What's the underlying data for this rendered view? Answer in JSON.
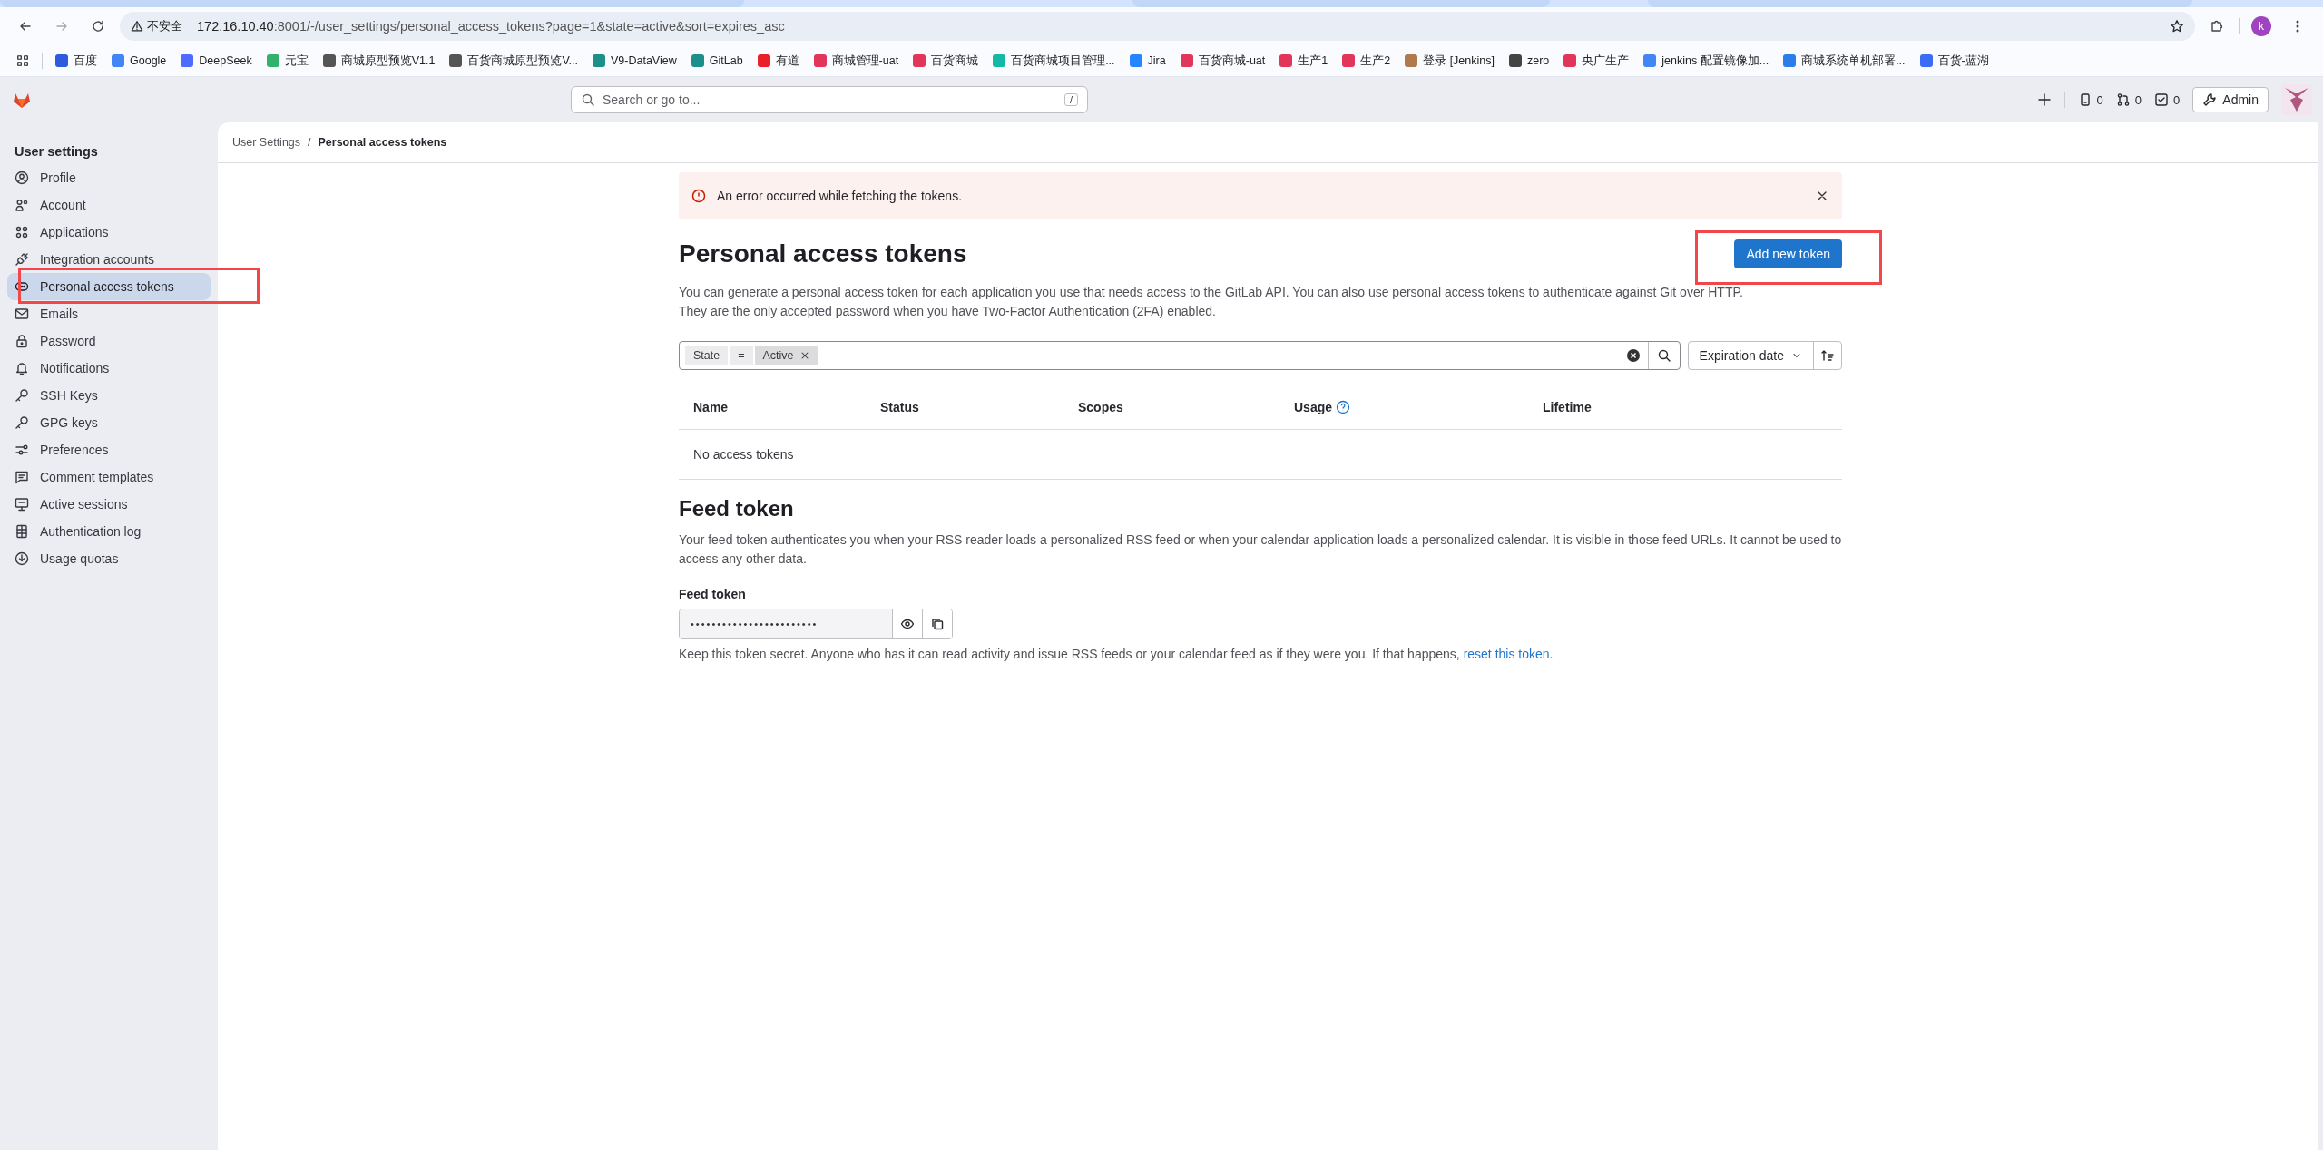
{
  "browser": {
    "security_label": "不安全",
    "url_host": "172.16.10.40",
    "url_rest": ":8001/-/user_settings/personal_access_tokens?page=1&state=active&sort=expires_asc",
    "profile_initial": "k"
  },
  "bookmarks": [
    {
      "label": "百度",
      "color": "#2e5bdb"
    },
    {
      "label": "Google",
      "color": "#4285f4"
    },
    {
      "label": "DeepSeek",
      "color": "#4d6bfe"
    },
    {
      "label": "元宝",
      "color": "#31b26b"
    },
    {
      "label": "商城原型预览V1.1",
      "color": "#555555"
    },
    {
      "label": "百货商城原型预览V...",
      "color": "#555555"
    },
    {
      "label": "V9-DataView",
      "color": "#1d8f8a"
    },
    {
      "label": "GitLab",
      "color": "#1d8f8a"
    },
    {
      "label": "有道",
      "color": "#e8202b"
    },
    {
      "label": "商城管理-uat",
      "color": "#e2355a"
    },
    {
      "label": "百货商城",
      "color": "#e2355a"
    },
    {
      "label": "百货商城项目管理...",
      "color": "#14b8a6"
    },
    {
      "label": "Jira",
      "color": "#2684ff"
    },
    {
      "label": "百货商城-uat",
      "color": "#e2355a"
    },
    {
      "label": "生产1",
      "color": "#e2355a"
    },
    {
      "label": "生产2",
      "color": "#e2355a"
    },
    {
      "label": "登录 [Jenkins]",
      "color": "#b07a4a"
    },
    {
      "label": "zero",
      "color": "#444444"
    },
    {
      "label": "央广生产",
      "color": "#e2355a"
    },
    {
      "label": "jenkins 配置镜像加...",
      "color": "#4285f4"
    },
    {
      "label": "商城系统单机部署...",
      "color": "#2b7de9"
    },
    {
      "label": "百货-蓝湖",
      "color": "#3b6cf6"
    }
  ],
  "header": {
    "search": {
      "placeholder": "Search or go to...",
      "shortcut": "/"
    },
    "issues_count": "0",
    "merge_requests_count": "0",
    "todos_count": "0",
    "admin_button": "Admin"
  },
  "sidebar": {
    "title": "User settings",
    "items": [
      {
        "label": "Profile",
        "selected": false
      },
      {
        "label": "Account",
        "selected": false
      },
      {
        "label": "Applications",
        "selected": false
      },
      {
        "label": "Integration accounts",
        "selected": false
      },
      {
        "label": "Personal access tokens",
        "selected": true
      },
      {
        "label": "Emails",
        "selected": false
      },
      {
        "label": "Password",
        "selected": false
      },
      {
        "label": "Notifications",
        "selected": false
      },
      {
        "label": "SSH Keys",
        "selected": false
      },
      {
        "label": "GPG keys",
        "selected": false
      },
      {
        "label": "Preferences",
        "selected": false
      },
      {
        "label": "Comment templates",
        "selected": false
      },
      {
        "label": "Active sessions",
        "selected": false
      },
      {
        "label": "Authentication log",
        "selected": false
      },
      {
        "label": "Usage quotas",
        "selected": false
      }
    ]
  },
  "breadcrumbs": [
    {
      "label": "User Settings"
    },
    {
      "label": "Personal access tokens"
    }
  ],
  "breadcrumb_separator": "/",
  "alert": {
    "message": "An error occurred while fetching the tokens."
  },
  "page": {
    "title": "Personal access tokens",
    "add_button": "Add new token",
    "description_lines": [
      "You can generate a personal access token for each application you use that needs access to the GitLab API. You can also use personal access tokens to authenticate against Git over HTTP.",
      "They are the only accepted password when you have Two-Factor Authentication (2FA) enabled."
    ]
  },
  "filter": {
    "token": {
      "name": "State",
      "operator": "=",
      "value": "Active"
    },
    "sort": "Expiration date"
  },
  "table": {
    "columns": [
      "Name",
      "Status",
      "Scopes",
      "Usage",
      "Lifetime"
    ],
    "empty_text": "No access tokens"
  },
  "feed_token": {
    "title": "Feed token",
    "description": "Your feed token authenticates you when your RSS reader loads a personalized RSS feed or when your calendar application loads a personalized calendar. It is visible in those feed URLs. It cannot be used to access any other data.",
    "label": "Feed token",
    "value": "••••••••••••••••••••••••",
    "help": "Keep this token secret. Anyone who has it can read activity and issue RSS feeds or your calendar feed as if they were you. If that happens,",
    "help_link": "reset this token",
    "help_end": "."
  },
  "annotations": [
    {
      "kind": "highlight"
    },
    {
      "kind": "highlight"
    }
  ]
}
